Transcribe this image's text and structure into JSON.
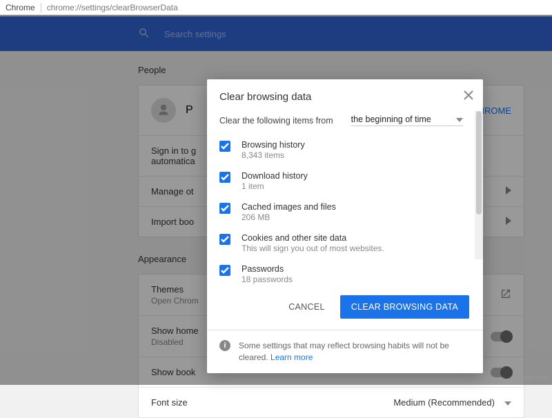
{
  "address_bar": {
    "label": "Chrome",
    "url": "chrome://settings/clearBrowserData"
  },
  "search": {
    "placeholder": "Search settings"
  },
  "people": {
    "heading": "People",
    "profile_label": "P",
    "signin_link": "SIGN IN TO CHROME",
    "signin_prompt_line1": "Sign in to g",
    "signin_prompt_line2": "automatica",
    "manage_row": "Manage ot",
    "import_row": "Import boo"
  },
  "appearance": {
    "heading": "Appearance",
    "themes_label": "Themes",
    "themes_sub": "Open Chrom",
    "show_home_label": "Show home",
    "show_home_sub": "Disabled",
    "show_book_label": "Show book",
    "font_label": "Font size",
    "font_value": "Medium (Recommended)"
  },
  "dialog": {
    "title": "Clear browsing data",
    "clear_from_label": "Clear the following items from",
    "time_range": "the beginning of time",
    "items": [
      {
        "label": "Browsing history",
        "sub": "8,343 items"
      },
      {
        "label": "Download history",
        "sub": "1 item"
      },
      {
        "label": "Cached images and files",
        "sub": "206 MB"
      },
      {
        "label": "Cookies and other site data",
        "sub": "This will sign you out of most websites."
      },
      {
        "label": "Passwords",
        "sub": "18 passwords"
      }
    ],
    "cancel": "CANCEL",
    "confirm": "CLEAR BROWSING DATA",
    "footer_text": "Some settings that may reflect browsing habits will not be cleared.  ",
    "learn_more": "Learn more"
  },
  "watermark": "wsxdn.com"
}
